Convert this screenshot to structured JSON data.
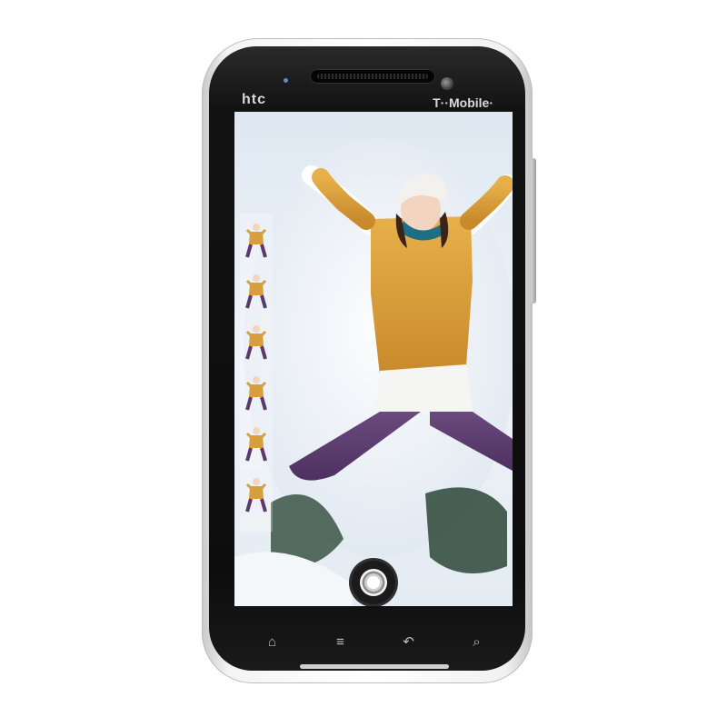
{
  "device": {
    "brand": "htc",
    "carrier": "T··Mobile·"
  },
  "screen": {
    "photo_subject": "",
    "shutter_icon": "camera-shutter-icon"
  },
  "nav_keys": [
    {
      "name": "home-icon",
      "glyph": "⌂"
    },
    {
      "name": "menu-icon",
      "glyph": "≡"
    },
    {
      "name": "back-icon",
      "glyph": "↶"
    },
    {
      "name": "search-icon",
      "glyph": "⌕"
    }
  ],
  "colors": {
    "body": "#ffffff",
    "bezel": "#0d0d0d",
    "jacket": "#d89e3a",
    "pants": "#5a3a6a",
    "snow": "#eef2f6"
  }
}
